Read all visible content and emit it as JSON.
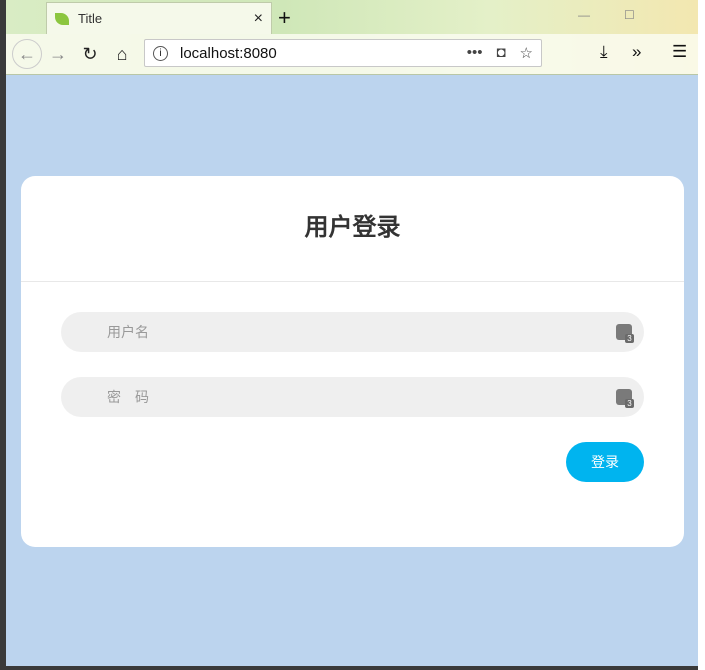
{
  "browser": {
    "tab_title": "Title",
    "url": "localhost:8080",
    "new_tab": "+",
    "close": "×"
  },
  "login": {
    "title": "用户登录",
    "username_placeholder": "用户名",
    "password_placeholder": "密　码",
    "submit": "登录"
  },
  "colors": {
    "accent": "#00b4ef",
    "page_bg": "#bcd4ee"
  }
}
